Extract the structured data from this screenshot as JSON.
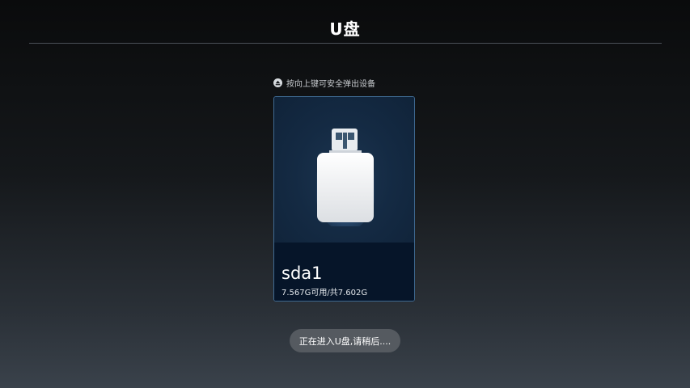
{
  "header": {
    "title": "U盘"
  },
  "hint": {
    "icon": "eject-icon",
    "text": "按向上键可安全弹出设备"
  },
  "device": {
    "icon": "usb-drive-icon",
    "name": "sda1",
    "capacity": "7.567G可用/共7.602G"
  },
  "toast": {
    "text": "正在进入U盘,请稍后...."
  },
  "colors": {
    "card_border": "#3f6a92",
    "card_background": "#0f1f33",
    "card_label_background": "#061529",
    "toast_background": "#555a60"
  }
}
